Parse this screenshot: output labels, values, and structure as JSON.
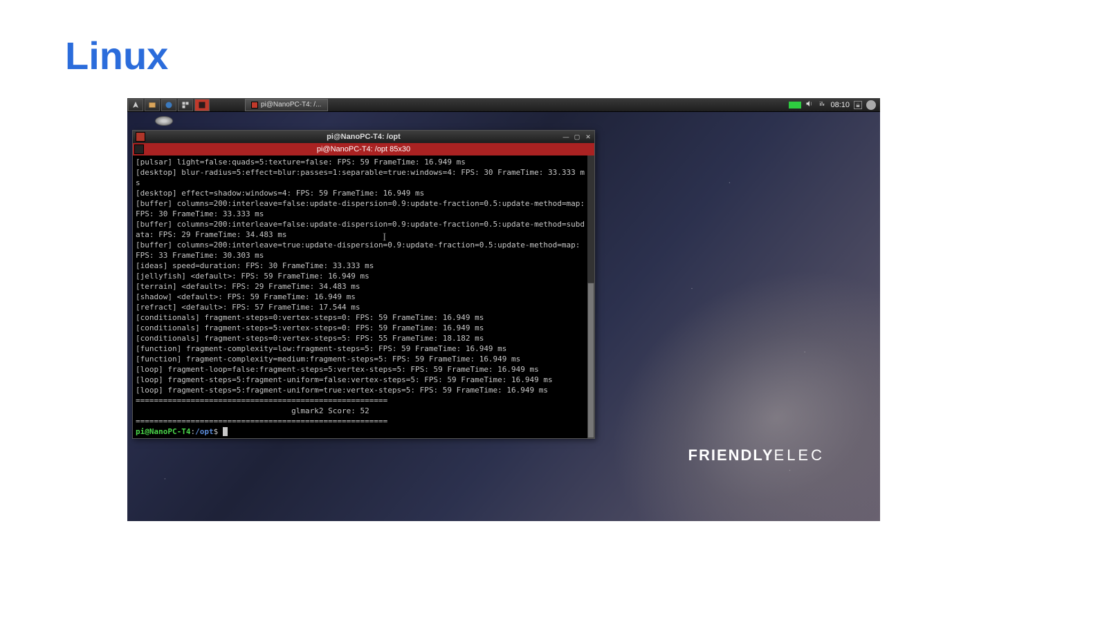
{
  "page": {
    "title": "Linux"
  },
  "taskbar": {
    "task_button_label": "pi@NanoPC-T4: /...",
    "clock": "08:10"
  },
  "brand": {
    "bold": "FRIENDLY",
    "thin": "ELEC"
  },
  "terminal": {
    "title": "pi@NanoPC-T4: /opt",
    "tab": "pi@NanoPC-T4: /opt 85x30",
    "lines": [
      "[pulsar] light=false:quads=5:texture=false: FPS: 59 FrameTime: 16.949 ms",
      "[desktop] blur-radius=5:effect=blur:passes=1:separable=true:windows=4: FPS: 30 FrameTime: 33.333 ms",
      "[desktop] effect=shadow:windows=4: FPS: 59 FrameTime: 16.949 ms",
      "[buffer] columns=200:interleave=false:update-dispersion=0.9:update-fraction=0.5:update-method=map: FPS: 30 FrameTime: 33.333 ms",
      "[buffer] columns=200:interleave=false:update-dispersion=0.9:update-fraction=0.5:update-method=subdata: FPS: 29 FrameTime: 34.483 ms",
      "[buffer] columns=200:interleave=true:update-dispersion=0.9:update-fraction=0.5:update-method=map: FPS: 33 FrameTime: 30.303 ms",
      "[ideas] speed=duration: FPS: 30 FrameTime: 33.333 ms",
      "[jellyfish] <default>: FPS: 59 FrameTime: 16.949 ms",
      "[terrain] <default>: FPS: 29 FrameTime: 34.483 ms",
      "[shadow] <default>: FPS: 59 FrameTime: 16.949 ms",
      "[refract] <default>: FPS: 57 FrameTime: 17.544 ms",
      "[conditionals] fragment-steps=0:vertex-steps=0: FPS: 59 FrameTime: 16.949 ms",
      "[conditionals] fragment-steps=5:vertex-steps=0: FPS: 59 FrameTime: 16.949 ms",
      "[conditionals] fragment-steps=0:vertex-steps=5: FPS: 55 FrameTime: 18.182 ms",
      "[function] fragment-complexity=low:fragment-steps=5: FPS: 59 FrameTime: 16.949 ms",
      "[function] fragment-complexity=medium:fragment-steps=5: FPS: 59 FrameTime: 16.949 ms",
      "[loop] fragment-loop=false:fragment-steps=5:vertex-steps=5: FPS: 59 FrameTime: 16.949 ms",
      "[loop] fragment-steps=5:fragment-uniform=false:vertex-steps=5: FPS: 59 FrameTime: 16.949 ms",
      "[loop] fragment-steps=5:fragment-uniform=true:vertex-steps=5: FPS: 59 FrameTime: 16.949 ms",
      "=======================================================",
      "                                  glmark2 Score: 52 ",
      "======================================================="
    ],
    "prompt": {
      "user": "pi@NanoPC-T4",
      "sep": ":",
      "path": "/opt",
      "end": "$ "
    }
  }
}
